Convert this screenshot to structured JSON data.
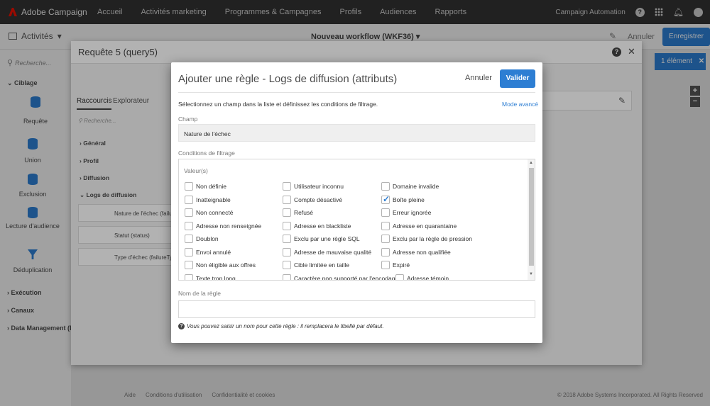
{
  "topbar": {
    "brand": "Adobe Campaign",
    "nav": [
      "Accueil",
      "Activités marketing",
      "Programmes & Campagnes",
      "Profils",
      "Audiences",
      "Rapports"
    ],
    "org": "Campaign Automation"
  },
  "subbar": {
    "activities_label": "Activités",
    "workflow_title": "Nouveau workflow (WKF36)",
    "cancel_label": "Annuler",
    "save_label": "Enregistrer",
    "selection_badge": "1 élément"
  },
  "sidebar": {
    "search_placeholder": "Recherche...",
    "section_targeting": "Ciblage",
    "items": [
      "Requête",
      "Union",
      "Exclusion",
      "Lecture d'audience",
      "Déduplication"
    ],
    "section_execution": "Exécution",
    "section_channels": "Canaux",
    "section_data": "Data Management (E"
  },
  "query_panel": {
    "title": "Requête 5 (query5)",
    "tabs": [
      "Raccourcis",
      "Explorateur"
    ],
    "search_placeholder": "Recherche...",
    "tree": [
      "Général",
      "Profil",
      "Diffusion",
      "Logs de diffusion"
    ],
    "fields": [
      "Nature de l'échec (failur",
      "Statut (status)",
      "Type d'échec (failureTyp"
    ]
  },
  "footer": {
    "links": [
      "Aide",
      "Conditions d'utilisation",
      "Confidentialité et cookies"
    ],
    "copyright": "© 2018 Adobe Systems Incorporated. All Rights Reserved"
  },
  "dialog": {
    "title": "Ajouter une règle - Logs de diffusion (attributs)",
    "cancel_label": "Annuler",
    "confirm_label": "Valider",
    "instruction": "Sélectionnez un champ dans la liste et définissez les conditions de filtrage.",
    "advanced_mode": "Mode avancé",
    "field_label": "Champ",
    "field_value": "Nature de l'échec",
    "conditions_label": "Conditions de filtrage",
    "values_label": "Valeur(s)",
    "checkboxes": [
      {
        "label": "Non définie",
        "checked": false
      },
      {
        "label": "Utilisateur inconnu",
        "checked": false
      },
      {
        "label": "Domaine invalide",
        "checked": false
      },
      {
        "label": "Inatteignable",
        "checked": false
      },
      {
        "label": "Compte désactivé",
        "checked": false
      },
      {
        "label": "Boîte pleine",
        "checked": true
      },
      {
        "label": "Non connecté",
        "checked": false
      },
      {
        "label": "Refusé",
        "checked": false
      },
      {
        "label": "Erreur ignorée",
        "checked": false
      },
      {
        "label": "Adresse non renseignée",
        "checked": false
      },
      {
        "label": "Adresse en blackliste",
        "checked": false
      },
      {
        "label": "Adresse en quarantaine",
        "checked": false
      },
      {
        "label": "Doublon",
        "checked": false
      },
      {
        "label": "Exclu par une règle SQL",
        "checked": false
      },
      {
        "label": "Exclu par la règle de pression",
        "checked": false
      },
      {
        "label": "Envoi annulé",
        "checked": false
      },
      {
        "label": "Adresse de mauvaise qualité",
        "checked": false
      },
      {
        "label": "Adresse non qualifiée",
        "checked": false
      },
      {
        "label": "Non éligible aux offres",
        "checked": false
      },
      {
        "label": "Cible limitée en taille",
        "checked": false
      },
      {
        "label": "Expiré",
        "checked": false
      },
      {
        "label": "Texte trop long",
        "checked": false
      },
      {
        "label": "Caractère non supporté par l'encodage",
        "checked": false
      },
      {
        "label": "Adresse témoin",
        "checked": false
      }
    ],
    "rule_name_label": "Nom de la règle",
    "rule_name_value": "",
    "hint": "Vous pouvez saisir un nom pour cette règle : il remplacera le libellé par défaut."
  }
}
